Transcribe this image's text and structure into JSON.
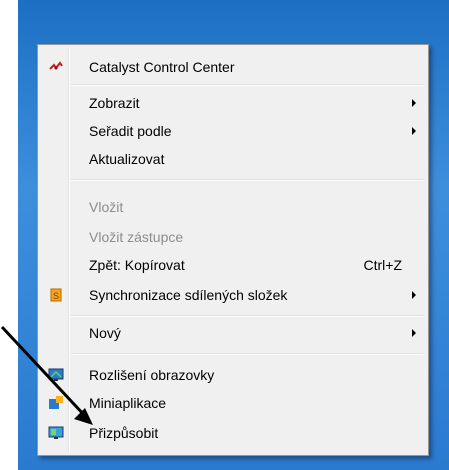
{
  "menu": {
    "items": [
      {
        "label": "Catalyst Control Center",
        "icon": "catalyst-icon"
      },
      {
        "label": "Zobrazit",
        "submenu": true
      },
      {
        "label": "Seřadit podle",
        "submenu": true
      },
      {
        "label": "Aktualizovat"
      },
      {
        "label": "Vložit",
        "disabled": true
      },
      {
        "label": "Vložit zástupce",
        "disabled": true
      },
      {
        "label": "Zpět: Kopírovat",
        "shortcut": "Ctrl+Z"
      },
      {
        "label": "Synchronizace sdílených složek",
        "submenu": true,
        "icon": "sync-icon"
      },
      {
        "label": "Nový",
        "submenu": true
      },
      {
        "label": "Rozlišení obrazovky",
        "icon": "monitor-icon"
      },
      {
        "label": "Miniaplikace",
        "icon": "gadgets-icon"
      },
      {
        "label": "Přizpůsobit",
        "icon": "personalize-icon"
      }
    ]
  },
  "colors": {
    "desktop": "#2a7ad0",
    "menu_bg": "#f0f0f0",
    "disabled_text": "#8d8d8d"
  }
}
